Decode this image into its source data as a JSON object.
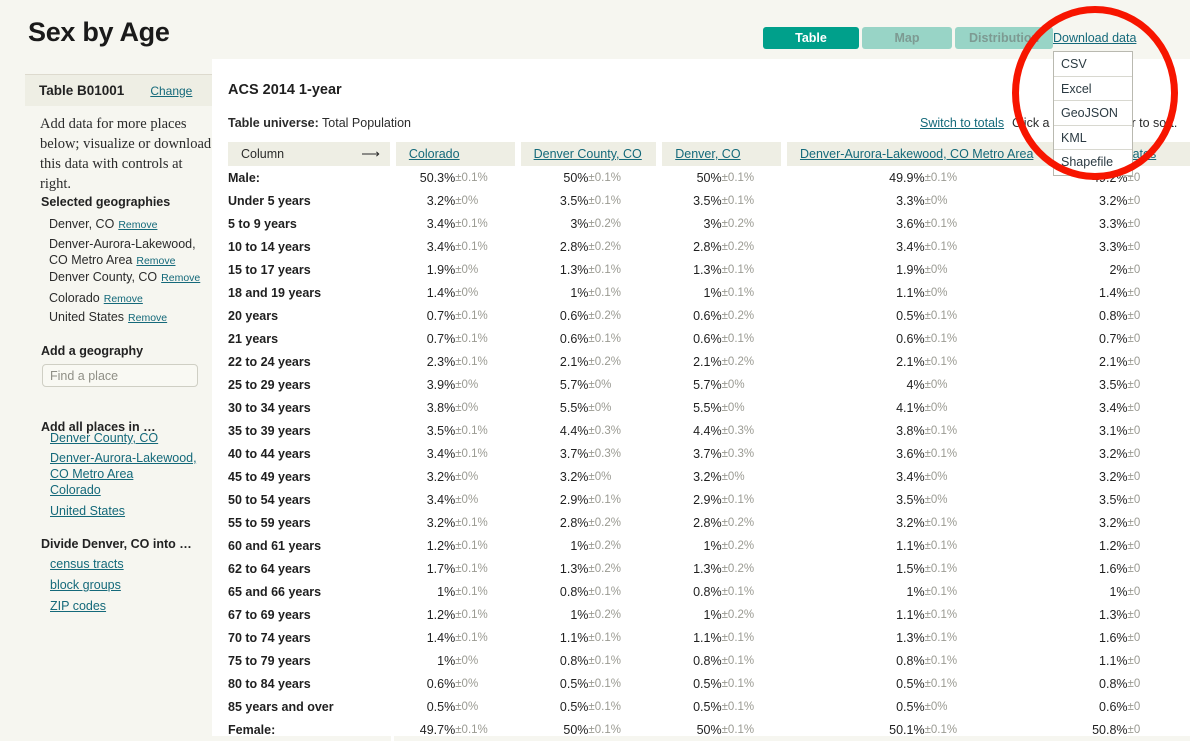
{
  "header": {
    "title": "Sex by Age",
    "tabs": [
      {
        "label": "Table",
        "active": true
      },
      {
        "label": "Map",
        "active": false
      },
      {
        "label": "Distribution",
        "active": false
      }
    ],
    "download": {
      "link_label": "Download data",
      "options": [
        "CSV",
        "Excel",
        "GeoJSON",
        "KML",
        "Shapefile"
      ]
    }
  },
  "sidebar": {
    "table_id": "Table B01001",
    "change_label": "Change",
    "intro": "Add data for more places below; visualize or download this data with controls at right.",
    "selected_heading": "Selected geographies",
    "remove_label": "Remove",
    "selected_geographies": [
      "Denver, CO",
      "Denver-Aurora-Lakewood, CO Metro Area",
      "Denver County, CO",
      "Colorado",
      "United States"
    ],
    "add_geography_heading": "Add a geography",
    "find_place_placeholder": "Find a place",
    "add_all_heading": "Add all places in …",
    "add_all_links": [
      "Denver County, CO",
      "Denver-Aurora-Lakewood, CO Metro Area",
      "Colorado",
      "United States"
    ],
    "divide_heading": "Divide Denver, CO into …",
    "divide_links": [
      "census tracts",
      "block groups",
      "ZIP codes"
    ]
  },
  "main": {
    "release_title": "ACS 2014 1-year",
    "universe_label": "Table universe:",
    "universe_value": "Total Population",
    "switch_to_totals": "Switch to totals",
    "click_hint": "Click a column header to sort.",
    "column_header_label": "Column",
    "column_header_arrow": "⟶",
    "geo_columns": [
      "Colorado",
      "Denver County, CO",
      "Denver, CO",
      "Denver-Aurora-Lakewood, CO Metro Area",
      "United States"
    ]
  },
  "colors": {
    "accent_teal": "#00a08b",
    "tab_inactive": "#98d4c6",
    "link": "#14697a",
    "page_bg": "#f6f6f0",
    "header_row_bg": "#eeeee4",
    "annotation_red": "#f71500",
    "moe_gray": "#9a9a92"
  },
  "chart_data": {
    "type": "table",
    "title": "Sex by Age — ACS 2014 1-year",
    "columns": [
      "Column",
      "Colorado",
      "Denver County, CO",
      "Denver, CO",
      "Denver-Aurora-Lakewood, CO Metro Area",
      "United States"
    ],
    "rows": [
      {
        "label": "Male:",
        "indent": 0,
        "values": [
          "50.3%",
          "50%",
          "50%",
          "49.9%",
          "49.2%"
        ],
        "moes": [
          "±0.1%",
          "±0.1%",
          "±0.1%",
          "±0.1%",
          "±0"
        ]
      },
      {
        "label": "Under 5 years",
        "indent": 1,
        "values": [
          "3.2%",
          "3.5%",
          "3.5%",
          "3.3%",
          "3.2%"
        ],
        "moes": [
          "±0%",
          "±0.1%",
          "±0.1%",
          "±0%",
          "±0"
        ]
      },
      {
        "label": "5 to 9 years",
        "indent": 1,
        "values": [
          "3.4%",
          "3%",
          "3%",
          "3.6%",
          "3.3%"
        ],
        "moes": [
          "±0.1%",
          "±0.2%",
          "±0.2%",
          "±0.1%",
          "±0"
        ]
      },
      {
        "label": "10 to 14 years",
        "indent": 1,
        "values": [
          "3.4%",
          "2.8%",
          "2.8%",
          "3.4%",
          "3.3%"
        ],
        "moes": [
          "±0.1%",
          "±0.2%",
          "±0.2%",
          "±0.1%",
          "±0"
        ]
      },
      {
        "label": "15 to 17 years",
        "indent": 1,
        "values": [
          "1.9%",
          "1.3%",
          "1.3%",
          "1.9%",
          "2%"
        ],
        "moes": [
          "±0%",
          "±0.1%",
          "±0.1%",
          "±0%",
          "±0"
        ]
      },
      {
        "label": "18 and 19 years",
        "indent": 1,
        "values": [
          "1.4%",
          "1%",
          "1%",
          "1.1%",
          "1.4%"
        ],
        "moes": [
          "±0%",
          "±0.1%",
          "±0.1%",
          "±0%",
          "±0"
        ]
      },
      {
        "label": "20 years",
        "indent": 1,
        "values": [
          "0.7%",
          "0.6%",
          "0.6%",
          "0.5%",
          "0.8%"
        ],
        "moes": [
          "±0.1%",
          "±0.2%",
          "±0.2%",
          "±0.1%",
          "±0"
        ]
      },
      {
        "label": "21 years",
        "indent": 1,
        "values": [
          "0.7%",
          "0.6%",
          "0.6%",
          "0.6%",
          "0.7%"
        ],
        "moes": [
          "±0.1%",
          "±0.1%",
          "±0.1%",
          "±0.1%",
          "±0"
        ]
      },
      {
        "label": "22 to 24 years",
        "indent": 1,
        "values": [
          "2.3%",
          "2.1%",
          "2.1%",
          "2.1%",
          "2.1%"
        ],
        "moes": [
          "±0.1%",
          "±0.2%",
          "±0.2%",
          "±0.1%",
          "±0"
        ]
      },
      {
        "label": "25 to 29 years",
        "indent": 1,
        "values": [
          "3.9%",
          "5.7%",
          "5.7%",
          "4%",
          "3.5%"
        ],
        "moes": [
          "±0%",
          "±0%",
          "±0%",
          "±0%",
          "±0"
        ]
      },
      {
        "label": "30 to 34 years",
        "indent": 1,
        "values": [
          "3.8%",
          "5.5%",
          "5.5%",
          "4.1%",
          "3.4%"
        ],
        "moes": [
          "±0%",
          "±0%",
          "±0%",
          "±0%",
          "±0"
        ]
      },
      {
        "label": "35 to 39 years",
        "indent": 1,
        "values": [
          "3.5%",
          "4.4%",
          "4.4%",
          "3.8%",
          "3.1%"
        ],
        "moes": [
          "±0.1%",
          "±0.3%",
          "±0.3%",
          "±0.1%",
          "±0"
        ]
      },
      {
        "label": "40 to 44 years",
        "indent": 1,
        "values": [
          "3.4%",
          "3.7%",
          "3.7%",
          "3.6%",
          "3.2%"
        ],
        "moes": [
          "±0.1%",
          "±0.3%",
          "±0.3%",
          "±0.1%",
          "±0"
        ]
      },
      {
        "label": "45 to 49 years",
        "indent": 1,
        "values": [
          "3.2%",
          "3.2%",
          "3.2%",
          "3.4%",
          "3.2%"
        ],
        "moes": [
          "±0%",
          "±0%",
          "±0%",
          "±0%",
          "±0"
        ]
      },
      {
        "label": "50 to 54 years",
        "indent": 1,
        "values": [
          "3.4%",
          "2.9%",
          "2.9%",
          "3.5%",
          "3.5%"
        ],
        "moes": [
          "±0%",
          "±0.1%",
          "±0.1%",
          "±0%",
          "±0"
        ]
      },
      {
        "label": "55 to 59 years",
        "indent": 1,
        "values": [
          "3.2%",
          "2.8%",
          "2.8%",
          "3.2%",
          "3.2%"
        ],
        "moes": [
          "±0.1%",
          "±0.2%",
          "±0.2%",
          "±0.1%",
          "±0"
        ]
      },
      {
        "label": "60 and 61 years",
        "indent": 1,
        "values": [
          "1.2%",
          "1%",
          "1%",
          "1.1%",
          "1.2%"
        ],
        "moes": [
          "±0.1%",
          "±0.2%",
          "±0.2%",
          "±0.1%",
          "±0"
        ]
      },
      {
        "label": "62 to 64 years",
        "indent": 1,
        "values": [
          "1.7%",
          "1.3%",
          "1.3%",
          "1.5%",
          "1.6%"
        ],
        "moes": [
          "±0.1%",
          "±0.2%",
          "±0.2%",
          "±0.1%",
          "±0"
        ]
      },
      {
        "label": "65 and 66 years",
        "indent": 1,
        "values": [
          "1%",
          "0.8%",
          "0.8%",
          "1%",
          "1%"
        ],
        "moes": [
          "±0.1%",
          "±0.1%",
          "±0.1%",
          "±0.1%",
          "±0"
        ]
      },
      {
        "label": "67 to 69 years",
        "indent": 1,
        "values": [
          "1.2%",
          "1%",
          "1%",
          "1.1%",
          "1.3%"
        ],
        "moes": [
          "±0.1%",
          "±0.2%",
          "±0.2%",
          "±0.1%",
          "±0"
        ]
      },
      {
        "label": "70 to 74 years",
        "indent": 1,
        "values": [
          "1.4%",
          "1.1%",
          "1.1%",
          "1.3%",
          "1.6%"
        ],
        "moes": [
          "±0.1%",
          "±0.1%",
          "±0.1%",
          "±0.1%",
          "±0"
        ]
      },
      {
        "label": "75 to 79 years",
        "indent": 1,
        "values": [
          "1%",
          "0.8%",
          "0.8%",
          "0.8%",
          "1.1%"
        ],
        "moes": [
          "±0%",
          "±0.1%",
          "±0.1%",
          "±0.1%",
          "±0"
        ]
      },
      {
        "label": "80 to 84 years",
        "indent": 1,
        "values": [
          "0.6%",
          "0.5%",
          "0.5%",
          "0.5%",
          "0.8%"
        ],
        "moes": [
          "±0%",
          "±0.1%",
          "±0.1%",
          "±0.1%",
          "±0"
        ]
      },
      {
        "label": "85 years and over",
        "indent": 1,
        "values": [
          "0.5%",
          "0.5%",
          "0.5%",
          "0.5%",
          "0.6%"
        ],
        "moes": [
          "±0%",
          "±0.1%",
          "±0.1%",
          "±0%",
          "±0"
        ]
      },
      {
        "label": "Female:",
        "indent": 0,
        "values": [
          "49.7%",
          "50%",
          "50%",
          "50.1%",
          "50.8%"
        ],
        "moes": [
          "±0.1%",
          "±0.1%",
          "±0.1%",
          "±0.1%",
          "±0"
        ]
      }
    ]
  }
}
